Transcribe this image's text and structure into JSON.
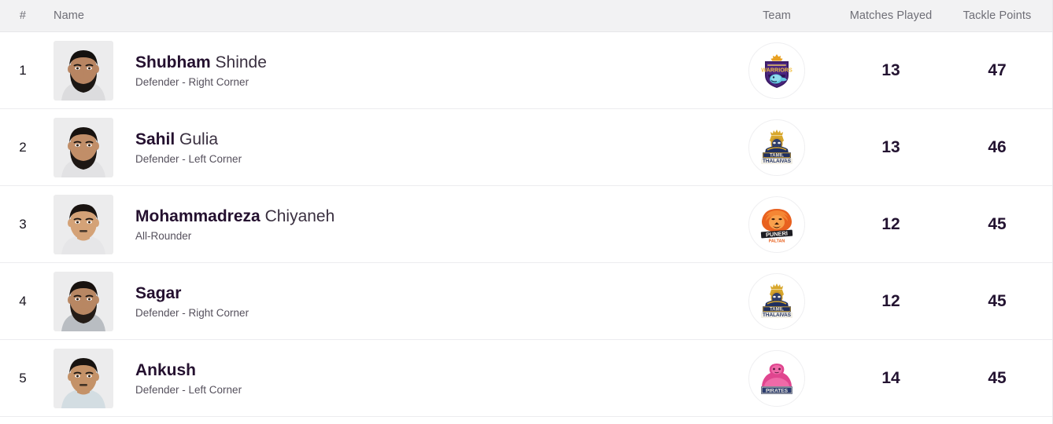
{
  "table": {
    "headers": {
      "rank": "#",
      "name": "Name",
      "team": "Team",
      "matches_played": "Matches Played",
      "tackle_points": "Tackle Points"
    },
    "rows": [
      {
        "rank": "1",
        "first_name": "Shubham",
        "last_name": "Shinde",
        "role": "Defender - Right Corner",
        "team_name": "Bengal Warriors",
        "team_logo_icon": "bengal-warriors-logo",
        "matches_played": "13",
        "tackle_points": "47"
      },
      {
        "rank": "2",
        "first_name": "Sahil",
        "last_name": "Gulia",
        "role": "Defender - Left Corner",
        "team_name": "Tamil Thalaivas",
        "team_logo_icon": "tamil-thalaivas-logo",
        "matches_played": "13",
        "tackle_points": "46"
      },
      {
        "rank": "3",
        "first_name": "Mohammadreza",
        "last_name": "Chiyaneh",
        "role": "All-Rounder",
        "team_name": "Puneri Paltan",
        "team_logo_icon": "puneri-paltan-logo",
        "matches_played": "12",
        "tackle_points": "45"
      },
      {
        "rank": "4",
        "first_name": "Sagar",
        "last_name": "",
        "role": "Defender - Right Corner",
        "team_name": "Tamil Thalaivas",
        "team_logo_icon": "tamil-thalaivas-logo",
        "matches_played": "12",
        "tackle_points": "45"
      },
      {
        "rank": "5",
        "first_name": "Ankush",
        "last_name": "",
        "role": "Defender - Left Corner",
        "team_name": "Patna Pirates",
        "team_logo_icon": "patna-pirates-logo",
        "matches_played": "14",
        "tackle_points": "45"
      }
    ]
  },
  "colors": {
    "header_bg": "#f2f2f3",
    "header_text": "#6e6e76",
    "row_border": "#ececef",
    "name_primary": "#24102f",
    "role_text": "#55505c",
    "stat_text": "#231331"
  }
}
